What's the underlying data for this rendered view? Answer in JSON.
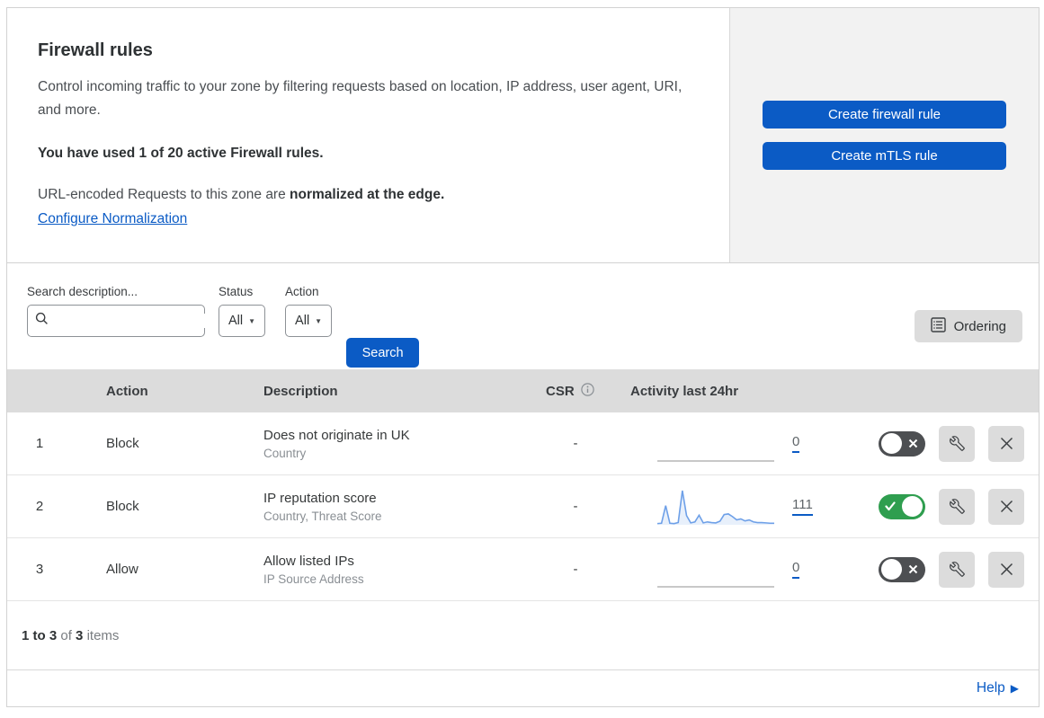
{
  "header": {
    "title": "Firewall rules",
    "description": "Control incoming traffic to your zone by filtering requests based on location, IP address, user agent, URI, and more.",
    "usage_notice": "You have used 1 of 20 active Firewall rules.",
    "normalization_prefix": "URL-encoded Requests to this zone are ",
    "normalization_bold": "normalized at the edge.",
    "normalization_link": "Configure Normalization",
    "create_firewall_button": "Create firewall rule",
    "create_mtls_button": "Create mTLS rule"
  },
  "filters": {
    "search_label": "Search description...",
    "status_label": "Status",
    "status_value": "All",
    "action_label": "Action",
    "action_value": "All",
    "search_button": "Search",
    "ordering_button": "Ordering"
  },
  "table": {
    "columns": {
      "action": "Action",
      "description": "Description",
      "csr": "CSR",
      "activity": "Activity last 24hr"
    },
    "rows": [
      {
        "number": "1",
        "action": "Block",
        "description": "Does not originate in UK",
        "fields": "Country",
        "csr": "-",
        "activity_count": "0",
        "enabled": false,
        "activity_sparkline": [
          0,
          0,
          0,
          0,
          0,
          0,
          0,
          0,
          0,
          0,
          0,
          0,
          0,
          0,
          0,
          0,
          0,
          0,
          0,
          0,
          0,
          0,
          0,
          0,
          0,
          0,
          0,
          0,
          0
        ]
      },
      {
        "number": "2",
        "action": "Block",
        "description": "IP reputation score",
        "fields": "Country, Threat Score",
        "csr": "-",
        "activity_count": "111",
        "enabled": true,
        "activity_sparkline": [
          1,
          2,
          55,
          2,
          1,
          4,
          100,
          25,
          3,
          6,
          26,
          3,
          6,
          4,
          3,
          8,
          28,
          30,
          22,
          12,
          15,
          9,
          12,
          6,
          4,
          4,
          3,
          2,
          2
        ]
      },
      {
        "number": "3",
        "action": "Allow",
        "description": "Allow listed IPs",
        "fields": "IP Source Address",
        "csr": "-",
        "activity_count": "0",
        "enabled": false,
        "activity_sparkline": [
          0,
          0,
          0,
          0,
          0,
          0,
          0,
          0,
          0,
          0,
          0,
          0,
          0,
          0,
          0,
          0,
          0,
          0,
          0,
          0,
          0,
          0,
          0,
          0,
          0,
          0,
          0,
          0,
          0
        ]
      }
    ]
  },
  "footer": {
    "pagination": {
      "range": "1 to 3",
      "of": "of",
      "total": "3",
      "items": "items"
    },
    "help_label": "Help"
  },
  "colors": {
    "primary_blue": "#0b5bc5",
    "toggle_on_green": "#2f9e4f",
    "toggle_off_gray": "#4d4f52",
    "panel_gray": "#f2f2f2",
    "table_header_gray": "#dcdcdc",
    "sparkline_blue": "#6ea0e8"
  }
}
